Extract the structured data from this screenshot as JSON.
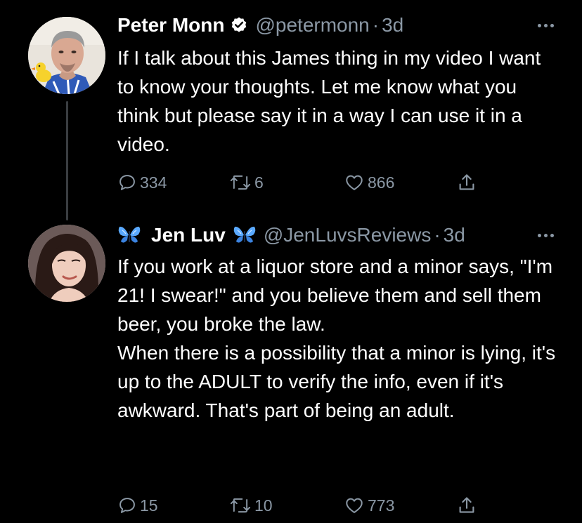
{
  "tweets": [
    {
      "author_name": "Peter Monn",
      "verified": true,
      "handle": "@petermonn",
      "separator": "·",
      "time": "3d",
      "text": [
        "If I talk about this James thing in my video I want to know your thoughts. Let me know what you think but please say it in a way I can use it in a video."
      ],
      "replies": "334",
      "retweets": "6",
      "likes": "866",
      "icons": [
        "reply-icon",
        "retweet-icon",
        "like-icon",
        "share-icon",
        "verified-badge-icon",
        "more-icon"
      ]
    },
    {
      "author_name": "Jen Luv",
      "verified": false,
      "handle": "@JenLuvsReviews",
      "separator": "·",
      "time": "3d",
      "text": [
        "If you work at a liquor store and a minor says, \"I'm 21! I swear!\" and you believe them and sell them beer, you broke the law.",
        "When there is a possibility that a minor is lying, it's up to the ADULT to verify the info, even if it's awkward. That's part of being an adult."
      ],
      "replies": "15",
      "retweets": "10",
      "likes": "773",
      "icons": [
        "butterfly-emoji-icon",
        "reply-icon",
        "retweet-icon",
        "like-icon",
        "share-icon",
        "more-icon"
      ]
    }
  ],
  "colors": {
    "background": "#000000",
    "text": "#ffffff",
    "secondary": "#8b98a5",
    "thread_line": "#3a3d41",
    "butterfly_blue": "#5aa9ff"
  }
}
